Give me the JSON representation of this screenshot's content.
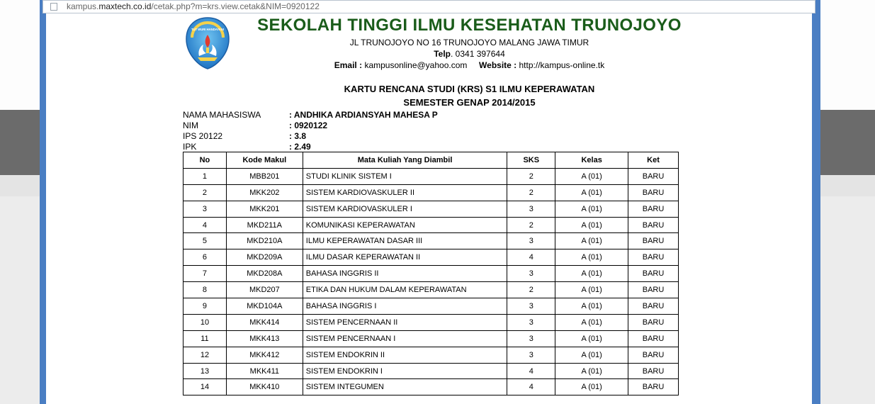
{
  "browser": {
    "url_prefix": "kampus.",
    "url_domain": "maxtech.co.id",
    "url_path": "/cetak.php?m=krs.view.cetak&NIM=0920122"
  },
  "header": {
    "school_name": "SEKOLAH TINGGI ILMU KESEHATAN TRUNOJOYO",
    "address": "JL TRUNOJOYO NO 16 TRUNOJOYO MALANG JAWA TIMUR",
    "telp_label": "Telp",
    "telp_value": ". 0341 397644",
    "email_label": "Email :",
    "email_value": " kampusonline@yahoo.com",
    "website_label": "Website :",
    "website_value": " http://kampus-online.tk",
    "logo_text": "TUT WURI HANDAYANI"
  },
  "krs": {
    "title": "KARTU RENCANA STUDI (KRS) S1 ILMU KEPERAWATAN",
    "semester": "SEMESTER GENAP 2014/2015"
  },
  "student": {
    "nama_label": "NAMA MAHASISWA",
    "nama_value": ": ANDHIKA ARDIANSYAH MAHESA P",
    "nim_label": "NIM",
    "nim_value": ": 0920122",
    "ips_label": "IPS 20122",
    "ips_value": ": 3.8",
    "ipk_label": "IPK",
    "ipk_value": ": 2.49"
  },
  "table": {
    "headers": [
      "No",
      "Kode Makul",
      "Mata Kuliah Yang Diambil",
      "SKS",
      "Kelas",
      "Ket"
    ],
    "rows": [
      [
        "1",
        "MBB201",
        "STUDI KLINIK SISTEM I",
        "2",
        "A (01)",
        "BARU"
      ],
      [
        "2",
        "MKK202",
        "SISTEM KARDIOVASKULER II",
        "2",
        "A (01)",
        "BARU"
      ],
      [
        "3",
        "MKK201",
        "SISTEM KARDIOVASKULER I",
        "3",
        "A (01)",
        "BARU"
      ],
      [
        "4",
        "MKD211A",
        "KOMUNIKASI KEPERAWATAN",
        "2",
        "A (01)",
        "BARU"
      ],
      [
        "5",
        "MKD210A",
        "ILMU KEPERAWATAN DASAR III",
        "3",
        "A (01)",
        "BARU"
      ],
      [
        "6",
        "MKD209A",
        "ILMU DASAR KEPERAWATAN II",
        "4",
        "A (01)",
        "BARU"
      ],
      [
        "7",
        "MKD208A",
        "BAHASA INGGRIS II",
        "3",
        "A (01)",
        "BARU"
      ],
      [
        "8",
        "MKD207",
        "ETIKA DAN HUKUM DALAM KEPERAWATAN",
        "2",
        "A (01)",
        "BARU"
      ],
      [
        "9",
        "MKD104A",
        "BAHASA INGGRIS I",
        "3",
        "A (01)",
        "BARU"
      ],
      [
        "10",
        "MKK414",
        "SISTEM PENCERNAAN II",
        "3",
        "A (01)",
        "BARU"
      ],
      [
        "11",
        "MKK413",
        "SISTEM PENCERNAAN I",
        "3",
        "A (01)",
        "BARU"
      ],
      [
        "12",
        "MKK412",
        "SISTEM ENDOKRIN II",
        "3",
        "A (01)",
        "BARU"
      ],
      [
        "13",
        "MKK411",
        "SISTEM ENDOKRIN I",
        "4",
        "A (01)",
        "BARU"
      ],
      [
        "14",
        "MKK410",
        "SISTEM INTEGUMEN",
        "4",
        "A (01)",
        "BARU"
      ]
    ]
  },
  "colors": {
    "window_frame": "#4a7ec3",
    "school_name": "#1a5c1a",
    "background_band": "#6b6b6b"
  },
  "icons": {
    "page": "page-icon",
    "logo": "tut-wuri-handayani-logo"
  }
}
